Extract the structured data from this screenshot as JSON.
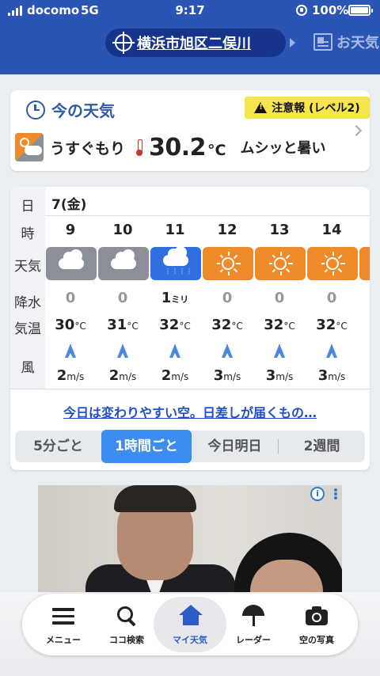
{
  "status_bar": {
    "carrier": "docomo",
    "network": "5G",
    "time": "9:17",
    "battery": "100%"
  },
  "header": {
    "location": "横浜市旭区二俣川",
    "next_tab": "お天気"
  },
  "now": {
    "title": "今の天気",
    "alert": "注意報 (レベル2)",
    "condition": "うすぐもり",
    "temp": "30.2",
    "temp_unit": "°C",
    "comment": "ムシッと暑い",
    "icon": "partly-cloudy-icon"
  },
  "hourly": {
    "labels": {
      "day": "日",
      "hour": "時",
      "weather": "天気",
      "precip": "降水",
      "temp": "気温",
      "wind": "風"
    },
    "day": "7(金)",
    "hours": [
      {
        "hour": "9",
        "weather": "cloudy",
        "precip": "0",
        "precip_unit": "",
        "temp": "30",
        "temp_unit": "°C",
        "wind": "2",
        "wind_unit": "m/s"
      },
      {
        "hour": "10",
        "weather": "cloudy",
        "precip": "0",
        "precip_unit": "",
        "temp": "31",
        "temp_unit": "°C",
        "wind": "2",
        "wind_unit": "m/s"
      },
      {
        "hour": "11",
        "weather": "rain",
        "precip": "1",
        "precip_unit": "ミリ",
        "temp": "32",
        "temp_unit": "°C",
        "wind": "2",
        "wind_unit": "m/s"
      },
      {
        "hour": "12",
        "weather": "sunny",
        "precip": "0",
        "precip_unit": "",
        "temp": "32",
        "temp_unit": "°C",
        "wind": "3",
        "wind_unit": "m/s"
      },
      {
        "hour": "13",
        "weather": "sunny",
        "precip": "0",
        "precip_unit": "",
        "temp": "32",
        "temp_unit": "°C",
        "wind": "3",
        "wind_unit": "m/s"
      },
      {
        "hour": "14",
        "weather": "sunny",
        "precip": "0",
        "precip_unit": "",
        "temp": "32",
        "temp_unit": "°C",
        "wind": "3",
        "wind_unit": "m/s"
      }
    ],
    "forecast_link": "今日は変わりやすい空。日差しが届くもの…",
    "segments": [
      "5分ごと",
      "1時間ごと",
      "今日明日",
      "2週間"
    ],
    "active_segment": "1時間ごと"
  },
  "ad": {
    "info_icon": "i"
  },
  "bottom_nav": {
    "items": [
      {
        "label": "メニュー",
        "icon": "menu-icon"
      },
      {
        "label": "ココ検索",
        "icon": "search-icon"
      },
      {
        "label": "マイ天気",
        "icon": "home-icon"
      },
      {
        "label": "レーダー",
        "icon": "umbrella-icon"
      },
      {
        "label": "空の写真",
        "icon": "camera-icon"
      }
    ],
    "active": "マイ天気"
  },
  "colors": {
    "header": "#2a55b5",
    "location_pill": "#16358a",
    "sunny": "#ee8a2a",
    "cloudy": "#8a8f98",
    "rain": "#2f6fe0",
    "alert": "#f7e64a",
    "active_tab": "#2c5cc5"
  }
}
